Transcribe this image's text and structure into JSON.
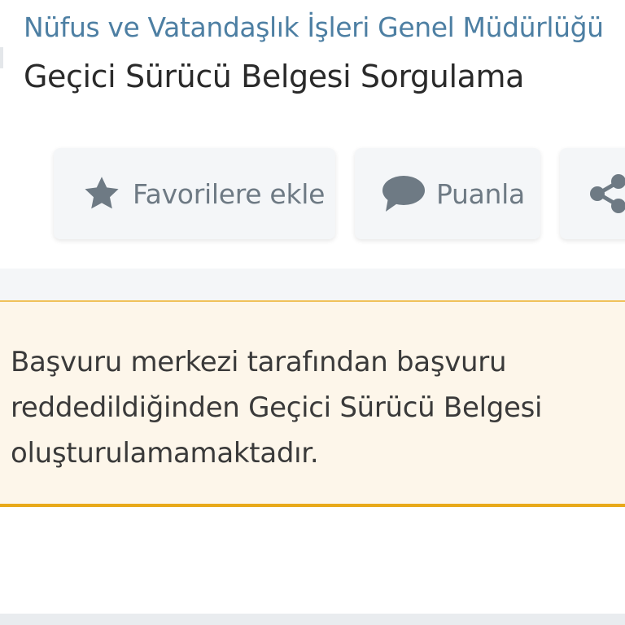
{
  "header": {
    "agency": "Nüfus ve Vatandaşlık İşleri Genel Müdürlüğü",
    "service_title": "Geçici Sürücü Belgesi Sorgulama"
  },
  "actions": {
    "favorite": {
      "label": "Favorilere ekle",
      "icon": "star-icon"
    },
    "rate": {
      "label": "Puanla",
      "icon": "speech-bubble-icon"
    },
    "share": {
      "icon": "share-icon"
    }
  },
  "alert": {
    "message": "Başvuru merkezi tarafından başvuru reddedildiğinden Geçici Sürücü Belgesi oluşturulamamaktadır."
  },
  "colors": {
    "agency_text": "#4d7fa3",
    "icon": "#6e7a84",
    "alert_background": "#fdf6ea",
    "alert_border": "#e8a91a"
  }
}
